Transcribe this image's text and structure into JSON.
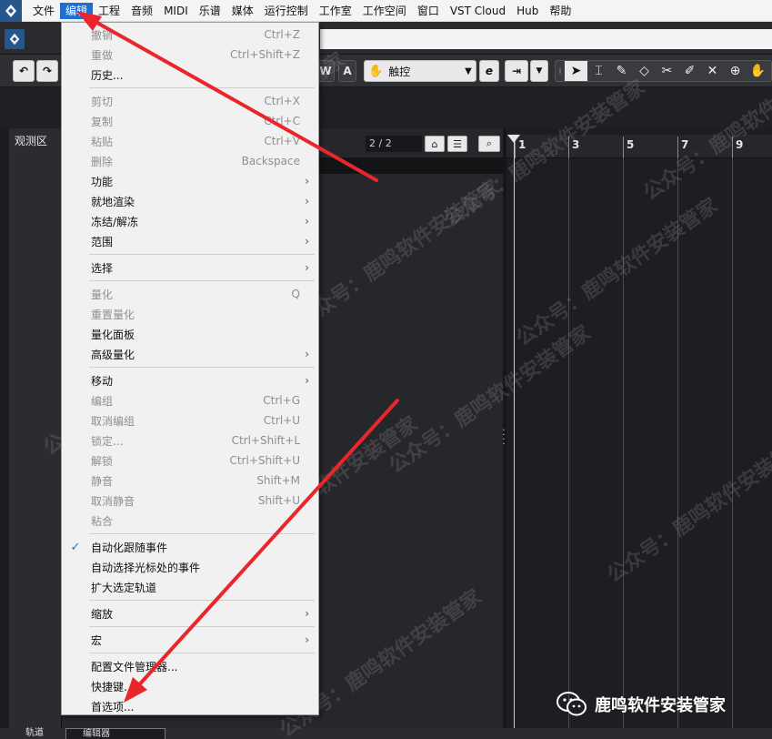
{
  "menubar": {
    "items": [
      {
        "label": "文件"
      },
      {
        "label": "编辑",
        "active": true
      },
      {
        "label": "工程"
      },
      {
        "label": "音频"
      },
      {
        "label": "MIDI"
      },
      {
        "label": "乐谱"
      },
      {
        "label": "媒体"
      },
      {
        "label": "运行控制"
      },
      {
        "label": "工作室"
      },
      {
        "label": "工作空间"
      },
      {
        "label": "窗口"
      },
      {
        "label": "VST Cloud"
      },
      {
        "label": "Hub"
      },
      {
        "label": "帮助"
      }
    ]
  },
  "toolbar": {
    "write_label": "W",
    "auto_label": "A",
    "mode_select": "触控",
    "mode_icon": "e"
  },
  "inspector": {
    "title": "观测区"
  },
  "tracklist": {
    "counter": "2 / 2"
  },
  "ruler": {
    "marks": [
      "1",
      "3",
      "5",
      "7",
      "9"
    ]
  },
  "bottom": {
    "label_left": "轨道",
    "tab_label": "编辑器"
  },
  "edit_menu": {
    "items": [
      {
        "label": "撤销",
        "shortcut": "Ctrl+Z",
        "disabled": true
      },
      {
        "label": "重做",
        "shortcut": "Ctrl+Shift+Z",
        "disabled": true
      },
      {
        "label": "历史...",
        "shortcut": ""
      },
      {
        "sep": true
      },
      {
        "label": "剪切",
        "shortcut": "Ctrl+X",
        "disabled": true
      },
      {
        "label": "复制",
        "shortcut": "Ctrl+C",
        "disabled": true
      },
      {
        "label": "粘贴",
        "shortcut": "Ctrl+V",
        "disabled": true
      },
      {
        "label": "删除",
        "shortcut": "Backspace",
        "disabled": true
      },
      {
        "label": "功能",
        "submenu": true
      },
      {
        "label": "就地渲染",
        "submenu": true
      },
      {
        "label": "冻结/解冻",
        "submenu": true
      },
      {
        "label": "范围",
        "submenu": true
      },
      {
        "sep": true
      },
      {
        "label": "选择",
        "submenu": true
      },
      {
        "sep": true
      },
      {
        "label": "量化",
        "shortcut": "Q",
        "disabled": true
      },
      {
        "label": "重置量化",
        "shortcut": "",
        "disabled": true
      },
      {
        "label": "量化面板",
        "shortcut": ""
      },
      {
        "label": "高级量化",
        "submenu": true
      },
      {
        "sep": true
      },
      {
        "label": "移动",
        "submenu": true
      },
      {
        "label": "编组",
        "shortcut": "Ctrl+G",
        "disabled": true
      },
      {
        "label": "取消编组",
        "shortcut": "Ctrl+U",
        "disabled": true
      },
      {
        "label": "锁定...",
        "shortcut": "Ctrl+Shift+L",
        "disabled": true
      },
      {
        "label": "解锁",
        "shortcut": "Ctrl+Shift+U",
        "disabled": true
      },
      {
        "label": "静音",
        "shortcut": "Shift+M",
        "disabled": true
      },
      {
        "label": "取消静音",
        "shortcut": "Shift+U",
        "disabled": true
      },
      {
        "label": "粘合",
        "shortcut": "",
        "disabled": true
      },
      {
        "sep": true
      },
      {
        "label": "自动化跟随事件",
        "checked": true
      },
      {
        "label": "自动选择光标处的事件"
      },
      {
        "label": "扩大选定轨道"
      },
      {
        "sep": true
      },
      {
        "label": "缩放",
        "submenu": true
      },
      {
        "sep": true
      },
      {
        "label": "宏",
        "submenu": true
      },
      {
        "sep": true
      },
      {
        "label": "配置文件管理器..."
      },
      {
        "label": "快捷键..."
      },
      {
        "label": "首选项..."
      }
    ]
  },
  "watermark": {
    "text": "公众号：鹿鸣软件安装管家"
  },
  "brand": {
    "text": "鹿鸣软件安装管家"
  },
  "colors": {
    "menu_active": "#1f6fd1",
    "arrow": "#e8262b",
    "app_logo": "#26578c"
  }
}
